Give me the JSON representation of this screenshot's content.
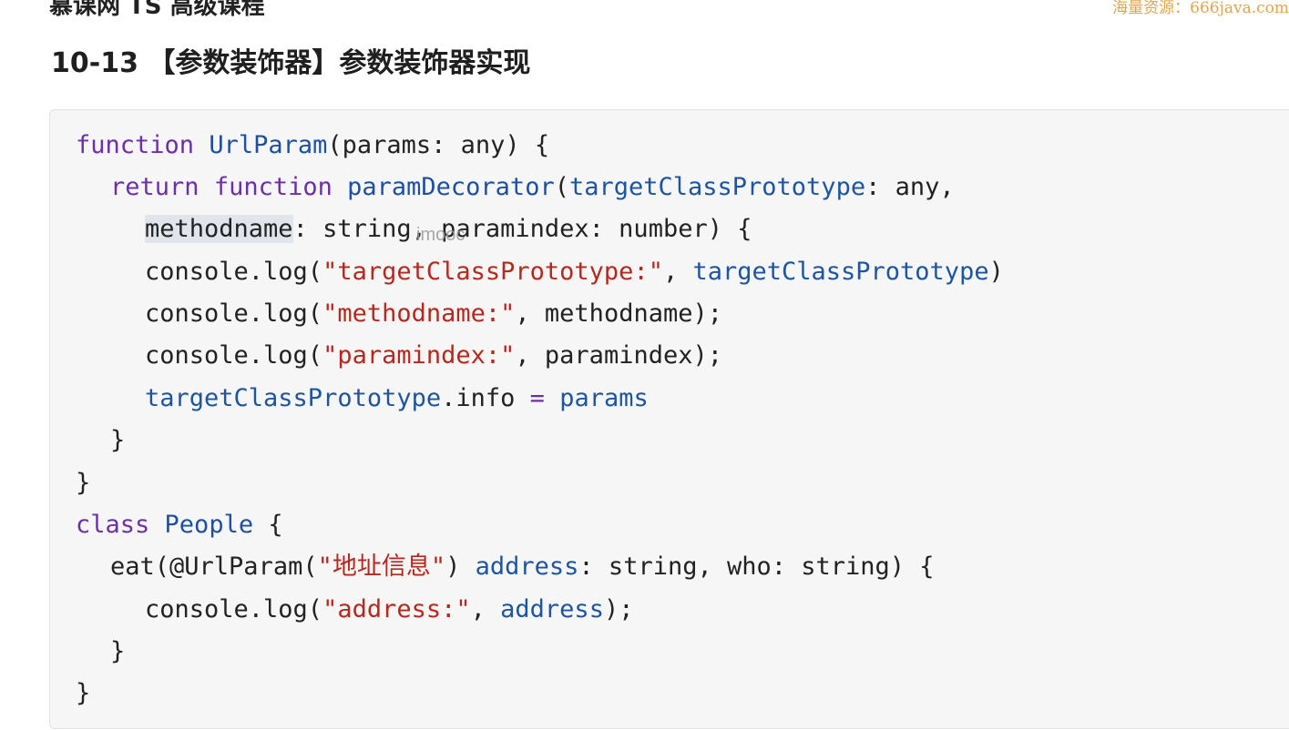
{
  "page": {
    "top_cut_text": "慕课网 TS 高级课程",
    "site_watermark": "海量资源：666java.com",
    "section_title": "10-13 【参数装饰器】参数装饰器实现",
    "imooc_watermark": "imooc"
  },
  "code": {
    "l1": {
      "t1": "function",
      "t2": " ",
      "t3": "UrlParam",
      "t4": "(params: any) {"
    },
    "l2": {
      "t1": "return",
      "t2": " ",
      "t3": "function",
      "t4": " ",
      "t5": "paramDecorator",
      "t6": "(",
      "t7": "targetClassPrototype",
      "t8": ": any,"
    },
    "l3": {
      "t1": "methodname",
      "t2": ": string, paramindex: number) {"
    },
    "l4": {
      "t1": "console.log(",
      "t2": "\"targetClassPrototype:\"",
      "t3": ", ",
      "t4": "targetClassPrototype",
      "t5": ")"
    },
    "l5": {
      "t1": "console.log(",
      "t2": "\"methodname:\"",
      "t3": ", methodname);"
    },
    "l6": {
      "t1": "console.log(",
      "t2": "\"paramindex:\"",
      "t3": ", paramindex);"
    },
    "l7": {
      "t1": "targetClassPrototype",
      "t2": ".info ",
      "t3": "=",
      "t4": " ",
      "t5": "params"
    },
    "l8": {
      "t1": "}"
    },
    "l9": {
      "t1": "}"
    },
    "l10": {
      "t1": "class",
      "t2": " ",
      "t3": "People",
      "t4": " {"
    },
    "l11": {
      "t1": "eat(",
      "t2": "@UrlParam(",
      "t3": "\"地址信息\"",
      "t4": ") ",
      "t5": "address",
      "t6": ": string, who: string) {"
    },
    "l12": {
      "t1": "console.log(",
      "t2": "\"address:\"",
      "t3": ", ",
      "t4": "address",
      "t5": ");"
    },
    "l13": {
      "t1": "}"
    },
    "l14": {
      "t1": "}"
    }
  },
  "colors": {
    "keyword": "#6b2fa8",
    "function_name": "#1f4fa3",
    "variable": "#1e55a0",
    "string": "#b5281e",
    "code_background": "#f6f6f7"
  }
}
